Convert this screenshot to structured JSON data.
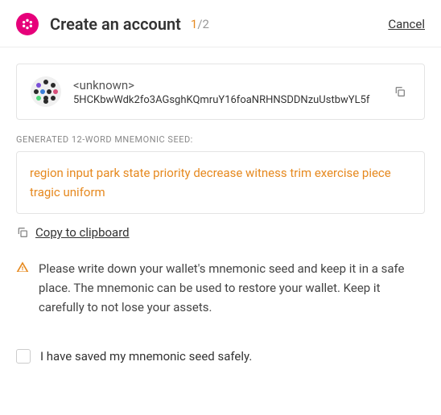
{
  "header": {
    "title": "Create an account",
    "step_current": "1",
    "step_total": "/2",
    "cancel": "Cancel"
  },
  "account": {
    "name": "<unknown>",
    "address": "5HCKbwWdk2fo3AGsghKQmruY16foaNRHNSDDNzuUstbwYL5f"
  },
  "seed": {
    "label": "GENERATED 12-WORD MNEMONIC SEED:",
    "phrase": "region input park state priority decrease witness trim exercise piece tragic uniform"
  },
  "actions": {
    "copy_clipboard": "Copy to clipboard"
  },
  "warning": "Please write down your wallet's mnemonic seed and keep it in a safe place. The mnemonic can be used to restore your wallet. Keep it carefully to not lose your assets.",
  "checkbox": {
    "label": "I have saved my mnemonic seed safely."
  }
}
